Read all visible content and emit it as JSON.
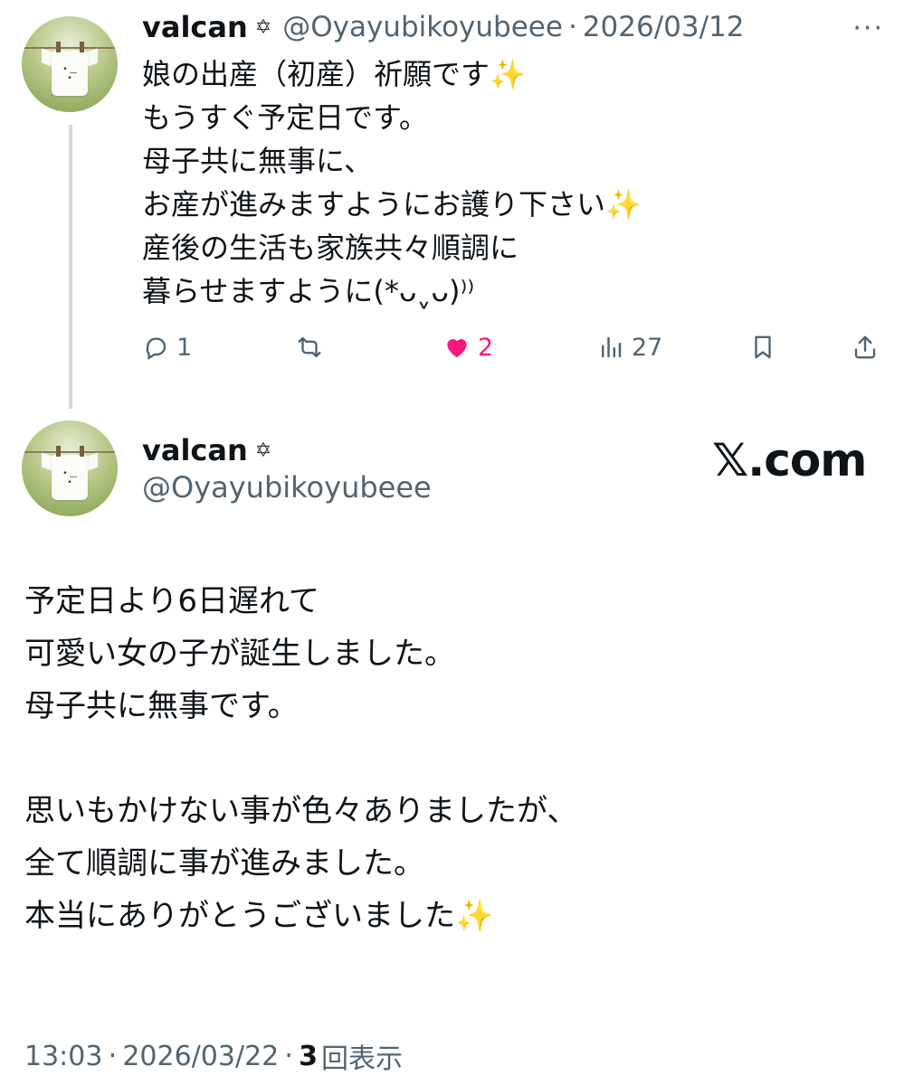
{
  "tweet1": {
    "name": "valcan",
    "badge": "✡",
    "handle": "@Oyayubikoyubeee",
    "separator": "·",
    "date": "2026/03/12",
    "more": "···",
    "lines": [
      "娘の出産（初産）祈願です",
      "もうすぐ予定日です。",
      "母子共に無事に、",
      "お産が進みますようにお護り下さい",
      "産後の生活も家族共々順調に",
      "暮らせますように(*ᴗˬᴗ)⁾⁾"
    ],
    "sparkle": "✨",
    "replies": "1",
    "likes": "2",
    "views": "27",
    "like_color": "#f91880"
  },
  "tweet2": {
    "name": "valcan",
    "badge": "✡",
    "handle": "@Oyayubikoyubeee",
    "logo": "𝕏.com",
    "lines": [
      "予定日より6日遅れて",
      "可愛い女の子が誕生しました。",
      "母子共に無事です。",
      "",
      "思いもかけない事が色々ありましたが、",
      "全て順調に事が進みました。",
      "本当にありがとうございました"
    ],
    "sparkle": "✨",
    "time": "13:03",
    "separator": "·",
    "date": "2026/03/22",
    "views_count": "3",
    "views_label": "回表示"
  },
  "icons": {
    "reply": "reply-icon",
    "retweet": "retweet-icon",
    "like": "heart-icon",
    "views": "views-icon",
    "bookmark": "bookmark-icon",
    "share": "share-icon"
  }
}
